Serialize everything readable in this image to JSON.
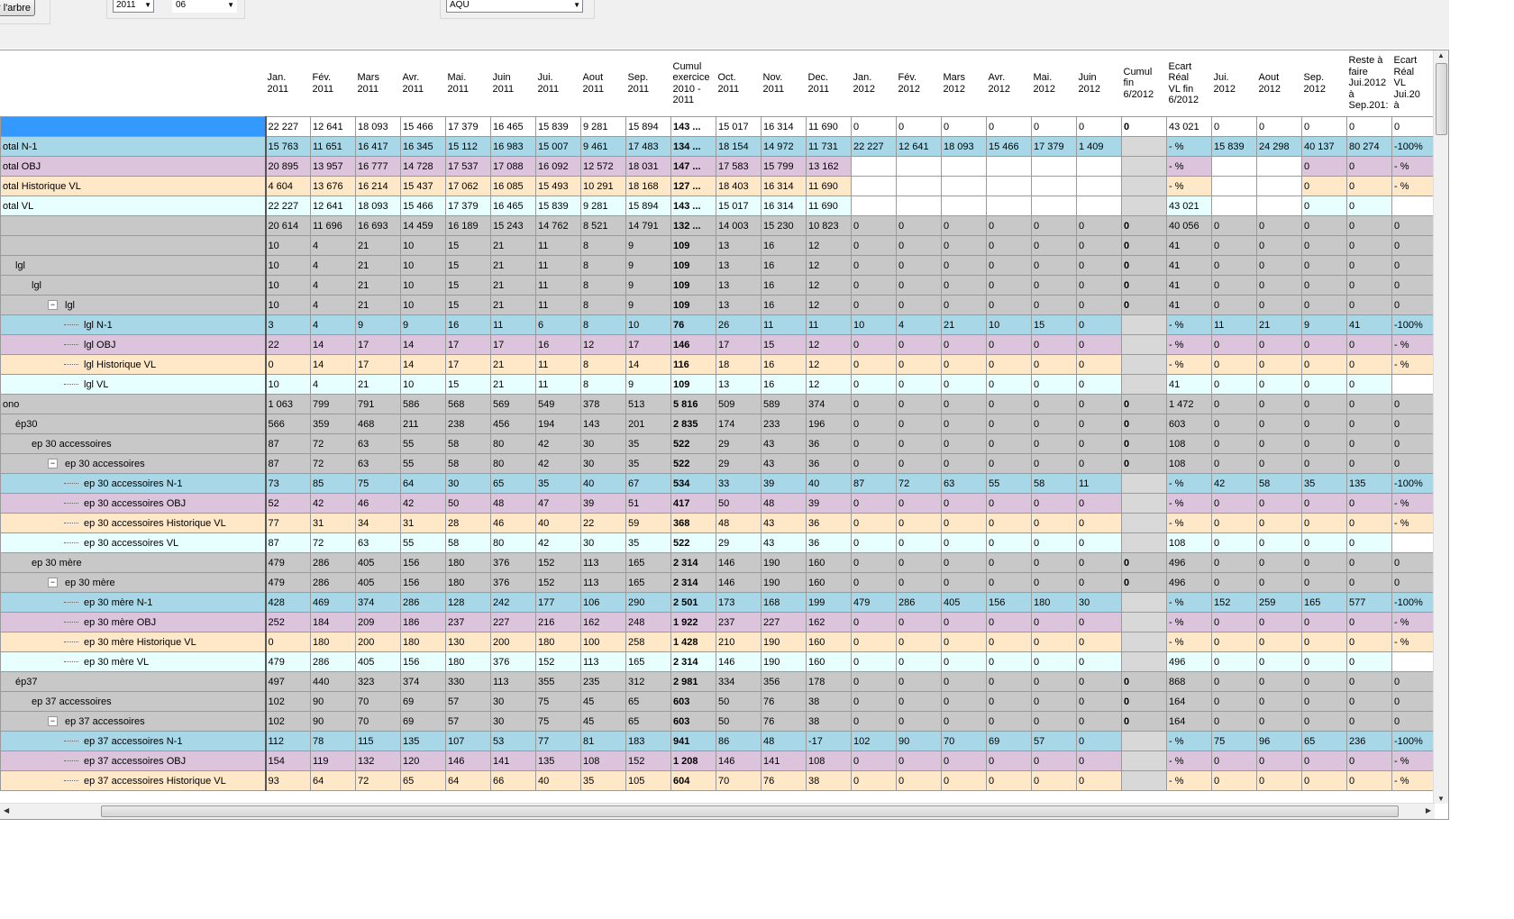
{
  "toolbar": {
    "tree_button_label": "r l'arbre",
    "year_value": "2011",
    "month_value": "06",
    "region_value": "AQU"
  },
  "columns": [
    "",
    "Jan.\n2011",
    "Fév.\n2011",
    "Mars\n2011",
    "Avr.\n2011",
    "Mai.\n2011",
    "Juin\n2011",
    "Jui.\n2011",
    "Aout\n2011",
    "Sep.\n2011",
    "Cumul\nexercice\n2010 -\n2011",
    "Oct.\n2011",
    "Nov.\n2011",
    "Dec.\n2011",
    "Jan.\n2012",
    "Fév.\n2012",
    "Mars\n2012",
    "Avr.\n2012",
    "Mai.\n2012",
    "Juin\n2012",
    "Cumul\nfin\n6/2012",
    "Ecart\nRéal\nVL fin\n6/2012",
    "Jui.\n2012",
    "Aout\n2012",
    "Sep.\n2012",
    "Reste à\nfaire\nJui.2012\nà\nSep.201:",
    "Ecart\nRéal\nVL\nJui.20\nà"
  ],
  "rows": [
    {
      "kind": "sel",
      "level": 0,
      "label": "",
      "cells": [
        "22 227",
        "12 641",
        "18 093",
        "15 466",
        "17 379",
        "16 465",
        "15 839",
        "9 281",
        "15 894",
        "143 ...",
        "15 017",
        "16 314",
        "11 690",
        "0",
        "0",
        "0",
        "0",
        "0",
        "0",
        "0",
        "43 021",
        "0",
        "0",
        "0",
        "0",
        "0"
      ]
    },
    {
      "kind": "blue",
      "level": 0,
      "label": "otal   N-1",
      "cells": [
        "15 763",
        "11 651",
        "16 417",
        "16 345",
        "15 112",
        "16 983",
        "15 007",
        "9 461",
        "17 483",
        "134 ...",
        "18 154",
        "14 972",
        "11 731",
        "22 227",
        "12 641",
        "18 093",
        "15 466",
        "17 379",
        "1 409",
        "",
        "- %",
        "15 839",
        "24 298",
        "40 137",
        "80 274",
        "-100%"
      ]
    },
    {
      "kind": "purple",
      "level": 0,
      "label": "otal   OBJ",
      "cells": [
        "20 895",
        "13 957",
        "16 777",
        "14 728",
        "17 537",
        "17 088",
        "16 092",
        "12 572",
        "18 031",
        "147 ...",
        "17 583",
        "15 799",
        "13 162",
        "",
        "",
        "",
        "",
        "",
        "",
        "",
        "- %",
        "",
        "",
        "0",
        "0",
        "- %"
      ]
    },
    {
      "kind": "orange",
      "level": 0,
      "label": "otal   Historique VL",
      "cells": [
        "4 604",
        "13 676",
        "16 214",
        "15 437",
        "17 062",
        "16 085",
        "15 493",
        "10 291",
        "18 168",
        "127 ...",
        "18 403",
        "16 314",
        "11 690",
        "",
        "",
        "",
        "",
        "",
        "",
        "",
        "- %",
        "",
        "",
        "0",
        "0",
        "- %"
      ]
    },
    {
      "kind": "cyan",
      "level": 0,
      "label": "otal   VL",
      "cells": [
        "22 227",
        "12 641",
        "18 093",
        "15 466",
        "17 379",
        "16 465",
        "15 839",
        "9 281",
        "15 894",
        "143 ...",
        "15 017",
        "16 314",
        "11 690",
        "",
        "",
        "",
        "",
        "",
        "",
        "",
        "43 021",
        "",
        "",
        "0",
        "0",
        ""
      ]
    },
    {
      "kind": "gray",
      "level": 0,
      "label": "",
      "cells": [
        "20 614",
        "11 696",
        "16 693",
        "14 459",
        "16 189",
        "15 243",
        "14 762",
        "8 521",
        "14 791",
        "132 ...",
        "14 003",
        "15 230",
        "10 823",
        "0",
        "0",
        "0",
        "0",
        "0",
        "0",
        "0",
        "40 056",
        "0",
        "0",
        "0",
        "0",
        "0"
      ]
    },
    {
      "kind": "gray",
      "level": 0,
      "label": "",
      "cells": [
        "10",
        "4",
        "21",
        "10",
        "15",
        "21",
        "11",
        "8",
        "9",
        "109",
        "13",
        "16",
        "12",
        "0",
        "0",
        "0",
        "0",
        "0",
        "0",
        "0",
        "41",
        "0",
        "0",
        "0",
        "0",
        "0"
      ]
    },
    {
      "kind": "gray",
      "level": 1,
      "label": "lgl",
      "cells": [
        "10",
        "4",
        "21",
        "10",
        "15",
        "21",
        "11",
        "8",
        "9",
        "109",
        "13",
        "16",
        "12",
        "0",
        "0",
        "0",
        "0",
        "0",
        "0",
        "0",
        "41",
        "0",
        "0",
        "0",
        "0",
        "0"
      ]
    },
    {
      "kind": "gray",
      "level": 2,
      "label": "lgl",
      "cells": [
        "10",
        "4",
        "21",
        "10",
        "15",
        "21",
        "11",
        "8",
        "9",
        "109",
        "13",
        "16",
        "12",
        "0",
        "0",
        "0",
        "0",
        "0",
        "0",
        "0",
        "41",
        "0",
        "0",
        "0",
        "0",
        "0"
      ]
    },
    {
      "kind": "gray",
      "level": 3,
      "exp": true,
      "label": "lgl",
      "cells": [
        "10",
        "4",
        "21",
        "10",
        "15",
        "21",
        "11",
        "8",
        "9",
        "109",
        "13",
        "16",
        "12",
        "0",
        "0",
        "0",
        "0",
        "0",
        "0",
        "0",
        "41",
        "0",
        "0",
        "0",
        "0",
        "0"
      ]
    },
    {
      "kind": "blue",
      "level": 4,
      "label": "lgl   N-1",
      "cells": [
        "3",
        "4",
        "9",
        "9",
        "16",
        "11",
        "6",
        "8",
        "10",
        "76",
        "26",
        "11",
        "11",
        "10",
        "4",
        "21",
        "10",
        "15",
        "0",
        "",
        "- %",
        "11",
        "21",
        "9",
        "41",
        "-100%"
      ]
    },
    {
      "kind": "purple",
      "level": 4,
      "label": "lgl   OBJ",
      "cells": [
        "22",
        "14",
        "17",
        "14",
        "17",
        "17",
        "16",
        "12",
        "17",
        "146",
        "17",
        "15",
        "12",
        "0",
        "0",
        "0",
        "0",
        "0",
        "0",
        "",
        "- %",
        "0",
        "0",
        "0",
        "0",
        "- %"
      ]
    },
    {
      "kind": "orange",
      "level": 4,
      "label": "lgl   Historique VL",
      "cells": [
        "0",
        "14",
        "17",
        "14",
        "17",
        "21",
        "11",
        "8",
        "14",
        "116",
        "18",
        "16",
        "12",
        "0",
        "0",
        "0",
        "0",
        "0",
        "0",
        "",
        "- %",
        "0",
        "0",
        "0",
        "0",
        "- %"
      ]
    },
    {
      "kind": "cyan",
      "level": 4,
      "label": "lgl   VL",
      "cells": [
        "10",
        "4",
        "21",
        "10",
        "15",
        "21",
        "11",
        "8",
        "9",
        "109",
        "13",
        "16",
        "12",
        "0",
        "0",
        "0",
        "0",
        "0",
        "0",
        "",
        "41",
        "0",
        "0",
        "0",
        "0",
        ""
      ]
    },
    {
      "kind": "gray",
      "level": 0,
      "label": "ono",
      "cells": [
        "1 063",
        "799",
        "791",
        "586",
        "568",
        "569",
        "549",
        "378",
        "513",
        "5 816",
        "509",
        "589",
        "374",
        "0",
        "0",
        "0",
        "0",
        "0",
        "0",
        "0",
        "1 472",
        "0",
        "0",
        "0",
        "0",
        "0"
      ]
    },
    {
      "kind": "gray",
      "level": 1,
      "label": "ép30",
      "cells": [
        "566",
        "359",
        "468",
        "211",
        "238",
        "456",
        "194",
        "143",
        "201",
        "2 835",
        "174",
        "233",
        "196",
        "0",
        "0",
        "0",
        "0",
        "0",
        "0",
        "0",
        "603",
        "0",
        "0",
        "0",
        "0",
        "0"
      ]
    },
    {
      "kind": "gray",
      "level": 2,
      "label": "ep 30 accessoires",
      "cells": [
        "87",
        "72",
        "63",
        "55",
        "58",
        "80",
        "42",
        "30",
        "35",
        "522",
        "29",
        "43",
        "36",
        "0",
        "0",
        "0",
        "0",
        "0",
        "0",
        "0",
        "108",
        "0",
        "0",
        "0",
        "0",
        "0"
      ]
    },
    {
      "kind": "gray",
      "level": 3,
      "exp": true,
      "label": "ep 30 accessoires",
      "cells": [
        "87",
        "72",
        "63",
        "55",
        "58",
        "80",
        "42",
        "30",
        "35",
        "522",
        "29",
        "43",
        "36",
        "0",
        "0",
        "0",
        "0",
        "0",
        "0",
        "0",
        "108",
        "0",
        "0",
        "0",
        "0",
        "0"
      ]
    },
    {
      "kind": "blue",
      "level": 4,
      "label": "ep 30 accessoires   N-1",
      "cells": [
        "73",
        "85",
        "75",
        "64",
        "30",
        "65",
        "35",
        "40",
        "67",
        "534",
        "33",
        "39",
        "40",
        "87",
        "72",
        "63",
        "55",
        "58",
        "11",
        "",
        "- %",
        "42",
        "58",
        "35",
        "135",
        "-100%"
      ]
    },
    {
      "kind": "purple",
      "level": 4,
      "label": "ep 30 accessoires   OBJ",
      "cells": [
        "52",
        "42",
        "46",
        "42",
        "50",
        "48",
        "47",
        "39",
        "51",
        "417",
        "50",
        "48",
        "39",
        "0",
        "0",
        "0",
        "0",
        "0",
        "0",
        "",
        "- %",
        "0",
        "0",
        "0",
        "0",
        "- %"
      ]
    },
    {
      "kind": "orange",
      "level": 4,
      "label": "ep 30 accessoires   Historique VL",
      "cells": [
        "77",
        "31",
        "34",
        "31",
        "28",
        "46",
        "40",
        "22",
        "59",
        "368",
        "48",
        "43",
        "36",
        "0",
        "0",
        "0",
        "0",
        "0",
        "0",
        "",
        "- %",
        "0",
        "0",
        "0",
        "0",
        "- %"
      ]
    },
    {
      "kind": "cyan",
      "level": 4,
      "label": "ep 30 accessoires   VL",
      "cells": [
        "87",
        "72",
        "63",
        "55",
        "58",
        "80",
        "42",
        "30",
        "35",
        "522",
        "29",
        "43",
        "36",
        "0",
        "0",
        "0",
        "0",
        "0",
        "0",
        "",
        "108",
        "0",
        "0",
        "0",
        "0",
        ""
      ]
    },
    {
      "kind": "gray",
      "level": 2,
      "label": "ep 30 mère",
      "cells": [
        "479",
        "286",
        "405",
        "156",
        "180",
        "376",
        "152",
        "113",
        "165",
        "2 314",
        "146",
        "190",
        "160",
        "0",
        "0",
        "0",
        "0",
        "0",
        "0",
        "0",
        "496",
        "0",
        "0",
        "0",
        "0",
        "0"
      ]
    },
    {
      "kind": "gray",
      "level": 3,
      "exp": true,
      "label": "ep 30 mère",
      "cells": [
        "479",
        "286",
        "405",
        "156",
        "180",
        "376",
        "152",
        "113",
        "165",
        "2 314",
        "146",
        "190",
        "160",
        "0",
        "0",
        "0",
        "0",
        "0",
        "0",
        "0",
        "496",
        "0",
        "0",
        "0",
        "0",
        "0"
      ]
    },
    {
      "kind": "blue",
      "level": 4,
      "label": "ep 30 mère   N-1",
      "cells": [
        "428",
        "469",
        "374",
        "286",
        "128",
        "242",
        "177",
        "106",
        "290",
        "2 501",
        "173",
        "168",
        "199",
        "479",
        "286",
        "405",
        "156",
        "180",
        "30",
        "",
        "- %",
        "152",
        "259",
        "165",
        "577",
        "-100%"
      ]
    },
    {
      "kind": "purple",
      "level": 4,
      "label": "ep 30 mère   OBJ",
      "cells": [
        "252",
        "184",
        "209",
        "186",
        "237",
        "227",
        "216",
        "162",
        "248",
        "1 922",
        "237",
        "227",
        "162",
        "0",
        "0",
        "0",
        "0",
        "0",
        "0",
        "",
        "- %",
        "0",
        "0",
        "0",
        "0",
        "- %"
      ]
    },
    {
      "kind": "orange",
      "level": 4,
      "label": "ep 30 mère   Historique VL",
      "cells": [
        "0",
        "180",
        "200",
        "180",
        "130",
        "200",
        "180",
        "100",
        "258",
        "1 428",
        "210",
        "190",
        "160",
        "0",
        "0",
        "0",
        "0",
        "0",
        "0",
        "",
        "- %",
        "0",
        "0",
        "0",
        "0",
        "- %"
      ]
    },
    {
      "kind": "cyan",
      "level": 4,
      "label": "ep 30 mère   VL",
      "cells": [
        "479",
        "286",
        "405",
        "156",
        "180",
        "376",
        "152",
        "113",
        "165",
        "2 314",
        "146",
        "190",
        "160",
        "0",
        "0",
        "0",
        "0",
        "0",
        "0",
        "",
        "496",
        "0",
        "0",
        "0",
        "0",
        ""
      ]
    },
    {
      "kind": "gray",
      "level": 1,
      "label": "ép37",
      "cells": [
        "497",
        "440",
        "323",
        "374",
        "330",
        "113",
        "355",
        "235",
        "312",
        "2 981",
        "334",
        "356",
        "178",
        "0",
        "0",
        "0",
        "0",
        "0",
        "0",
        "0",
        "868",
        "0",
        "0",
        "0",
        "0",
        "0"
      ]
    },
    {
      "kind": "gray",
      "level": 2,
      "label": "ep 37 accessoires",
      "cells": [
        "102",
        "90",
        "70",
        "69",
        "57",
        "30",
        "75",
        "45",
        "65",
        "603",
        "50",
        "76",
        "38",
        "0",
        "0",
        "0",
        "0",
        "0",
        "0",
        "0",
        "164",
        "0",
        "0",
        "0",
        "0",
        "0"
      ]
    },
    {
      "kind": "gray",
      "level": 3,
      "exp": true,
      "label": "ep 37 accessoires",
      "cells": [
        "102",
        "90",
        "70",
        "69",
        "57",
        "30",
        "75",
        "45",
        "65",
        "603",
        "50",
        "76",
        "38",
        "0",
        "0",
        "0",
        "0",
        "0",
        "0",
        "0",
        "164",
        "0",
        "0",
        "0",
        "0",
        "0"
      ]
    },
    {
      "kind": "blue",
      "level": 4,
      "label": "ep 37 accessoires   N-1",
      "cells": [
        "112",
        "78",
        "115",
        "135",
        "107",
        "53",
        "77",
        "81",
        "183",
        "941",
        "86",
        "48",
        "-17",
        "102",
        "90",
        "70",
        "69",
        "57",
        "0",
        "",
        "- %",
        "75",
        "96",
        "65",
        "236",
        "-100%"
      ]
    },
    {
      "kind": "purple",
      "level": 4,
      "label": "ep 37 accessoires   OBJ",
      "cells": [
        "154",
        "119",
        "132",
        "120",
        "146",
        "141",
        "135",
        "108",
        "152",
        "1 208",
        "146",
        "141",
        "108",
        "0",
        "0",
        "0",
        "0",
        "0",
        "0",
        "",
        "- %",
        "0",
        "0",
        "0",
        "0",
        "- %"
      ]
    },
    {
      "kind": "orange",
      "level": 4,
      "label": "ep 37 accessoires   Historique VL",
      "cells": [
        "93",
        "64",
        "72",
        "65",
        "64",
        "66",
        "40",
        "35",
        "105",
        "604",
        "70",
        "76",
        "38",
        "0",
        "0",
        "0",
        "0",
        "0",
        "0",
        "",
        "- %",
        "0",
        "0",
        "0",
        "0",
        "- %"
      ]
    }
  ],
  "colors": {
    "selected": "#3399ff",
    "n1": "#a8d8e8",
    "obj": "#dcc4dc",
    "historique": "#ffe8c8",
    "vl": "#e8ffff",
    "group": "#c8c8c8"
  },
  "icons": {
    "expander": "minus-box-icon",
    "scroll_left": "arrow-left-icon",
    "scroll_right": "arrow-right-icon",
    "scroll_up": "arrow-up-icon",
    "scroll_down": "arrow-down-icon"
  }
}
